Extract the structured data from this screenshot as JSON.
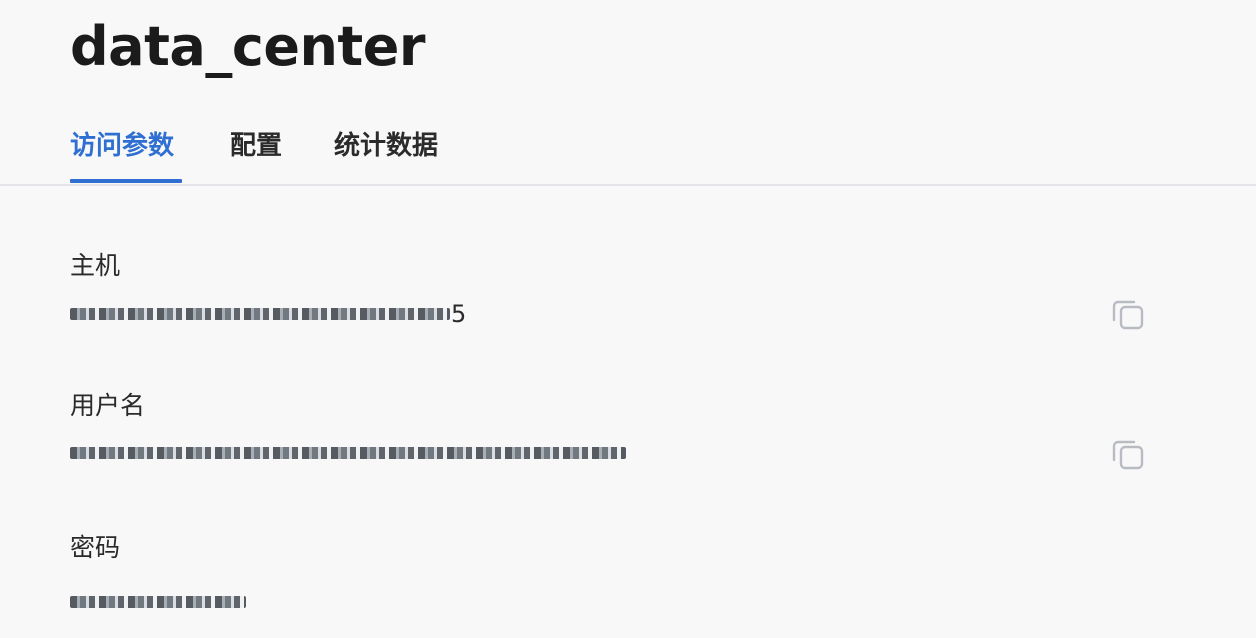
{
  "header": {
    "title": "data_center"
  },
  "tabs": [
    {
      "label": "访问参数",
      "active": true
    },
    {
      "label": "配置",
      "active": false
    },
    {
      "label": "统计数据",
      "active": false
    }
  ],
  "fields": {
    "host": {
      "label": "主机",
      "value_visible_suffix": "5",
      "copy_icon": "copy-icon"
    },
    "username": {
      "label": "用户名",
      "copy_icon": "copy-icon"
    },
    "password": {
      "label": "密码"
    }
  },
  "colors": {
    "accent": "#2f6fd1",
    "background": "#f8f8f8",
    "divider": "#e3e5e8",
    "icon": "#b8bcc2"
  }
}
